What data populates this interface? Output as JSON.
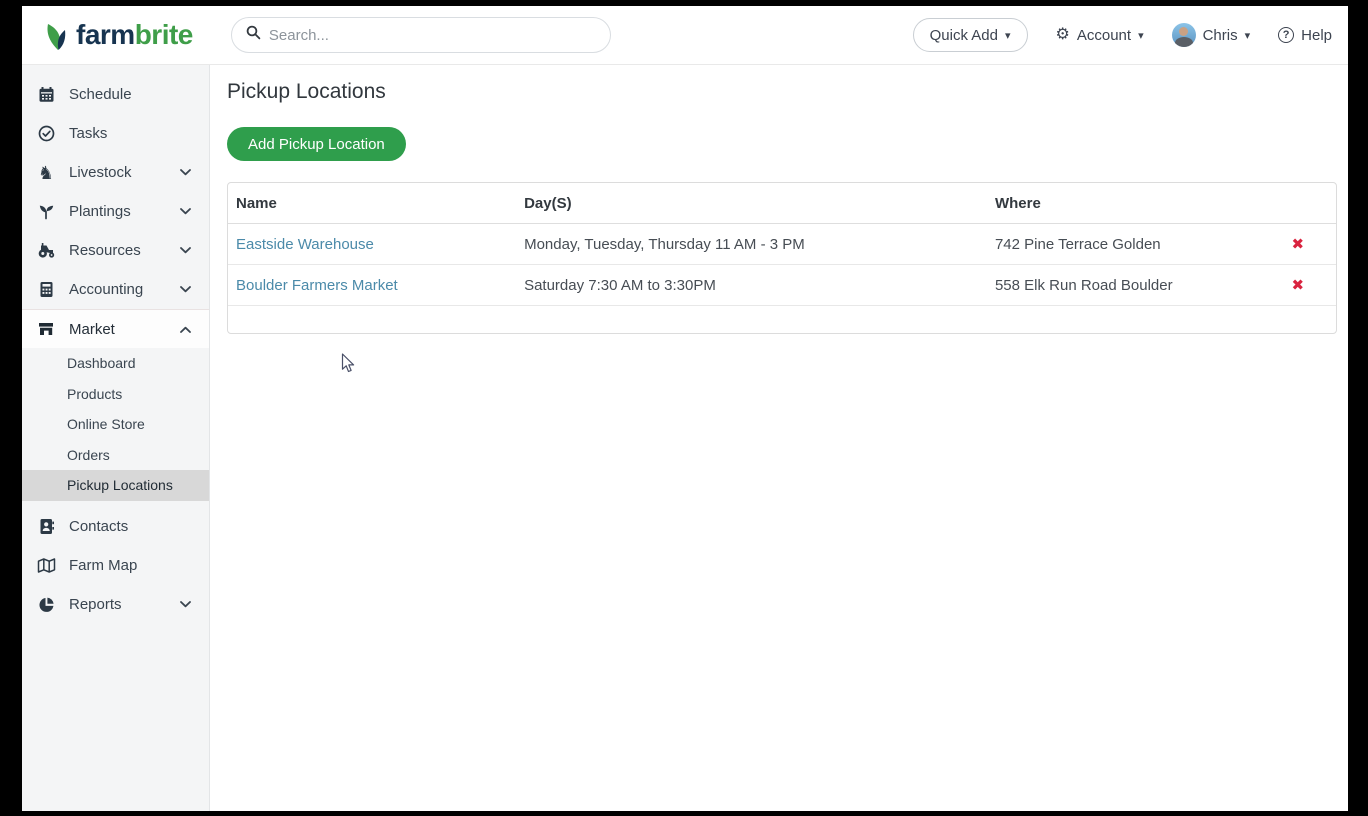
{
  "header": {
    "logo_farm": "farm",
    "logo_brite": "brite",
    "search_placeholder": "Search...",
    "quick_add_label": "Quick Add",
    "account_label": "Account",
    "user_name": "Chris",
    "help_label": "Help"
  },
  "icons": {
    "caret_down": "▾",
    "gear": "⚙",
    "help_mark": "?",
    "delete_x": "✖",
    "livestock_horse": "♞"
  },
  "sidebar": {
    "items": [
      {
        "label": "Schedule"
      },
      {
        "label": "Tasks"
      },
      {
        "label": "Livestock"
      },
      {
        "label": "Plantings"
      },
      {
        "label": "Resources"
      },
      {
        "label": "Accounting"
      },
      {
        "label": "Market"
      },
      {
        "label": "Contacts"
      },
      {
        "label": "Farm Map"
      },
      {
        "label": "Reports"
      }
    ],
    "market_subitems": [
      {
        "label": "Dashboard"
      },
      {
        "label": "Products"
      },
      {
        "label": "Online Store"
      },
      {
        "label": "Orders"
      },
      {
        "label": "Pickup Locations"
      }
    ],
    "active_section": "Market",
    "active_item": "Pickup Locations"
  },
  "main": {
    "title": "Pickup Locations",
    "add_button_label": "Add Pickup Location",
    "table": {
      "columns": [
        "Name",
        "Day(S)",
        "Where"
      ],
      "rows": [
        {
          "name": "Eastside Warehouse",
          "days": "Monday, Tuesday, Thursday 11 AM - 3 PM",
          "where": "742 Pine Terrace Golden"
        },
        {
          "name": "Boulder Farmers Market",
          "days": "Saturday 7:30 AM to 3:30PM",
          "where": "558 Elk Run Road Boulder"
        }
      ]
    }
  },
  "colors": {
    "brand_green": "#3f9e49",
    "brand_navy": "#173450",
    "button_green": "#2f9e4c",
    "link_blue": "#4b8aa9",
    "delete_red": "#d9233f",
    "sidebar_bg": "#f4f5f6",
    "active_item_bg": "#d8d8d8"
  }
}
